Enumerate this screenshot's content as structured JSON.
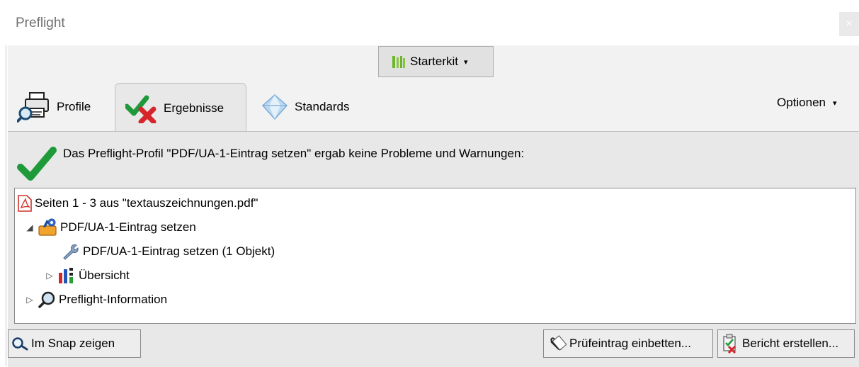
{
  "window": {
    "title": "Preflight",
    "close_glyph": "×"
  },
  "toolbar": {
    "starterkit_label": "Starterkit",
    "starterkit_caret": "▾"
  },
  "tabs": [
    {
      "label": "Profile",
      "icon": "printer-magnifier-icon",
      "selected": false
    },
    {
      "label": "Ergebnisse",
      "icon": "check-cross-icon",
      "selected": true
    },
    {
      "label": "Standards",
      "icon": "diamond-icon",
      "selected": false
    }
  ],
  "options": {
    "label": "Optionen",
    "caret": "▾"
  },
  "result": {
    "summary": "Das Preflight-Profil \"PDF/UA-1-Eintrag setzen\" ergab keine Probleme und Warnungen:",
    "status_icon": "big-green-check-icon"
  },
  "tree": {
    "items": [
      {
        "label": "Seiten 1 - 3 aus \"textauszeichnungen.pdf\"",
        "icon": "pdf-icon",
        "expander": ""
      },
      {
        "label": "PDF/UA-1-Eintrag setzen",
        "icon": "fixup-toolbox-icon",
        "expander": "◢"
      },
      {
        "label": "PDF/UA-1-Eintrag setzen (1 Objekt)",
        "icon": "wrench-icon",
        "expander": ""
      },
      {
        "label": "Übersicht",
        "icon": "chart-icon",
        "expander": "▷"
      },
      {
        "label": "Preflight-Information",
        "icon": "magnifier-icon",
        "expander": "▷"
      }
    ]
  },
  "buttons": {
    "snap": "Im Snap zeigen",
    "embed": "Prüfeintrag einbetten...",
    "report": "Bericht erstellen..."
  },
  "colors": {
    "accent_green": "#1f9a3a",
    "error_red": "#d6262b",
    "pdf_red": "#d0312d"
  }
}
